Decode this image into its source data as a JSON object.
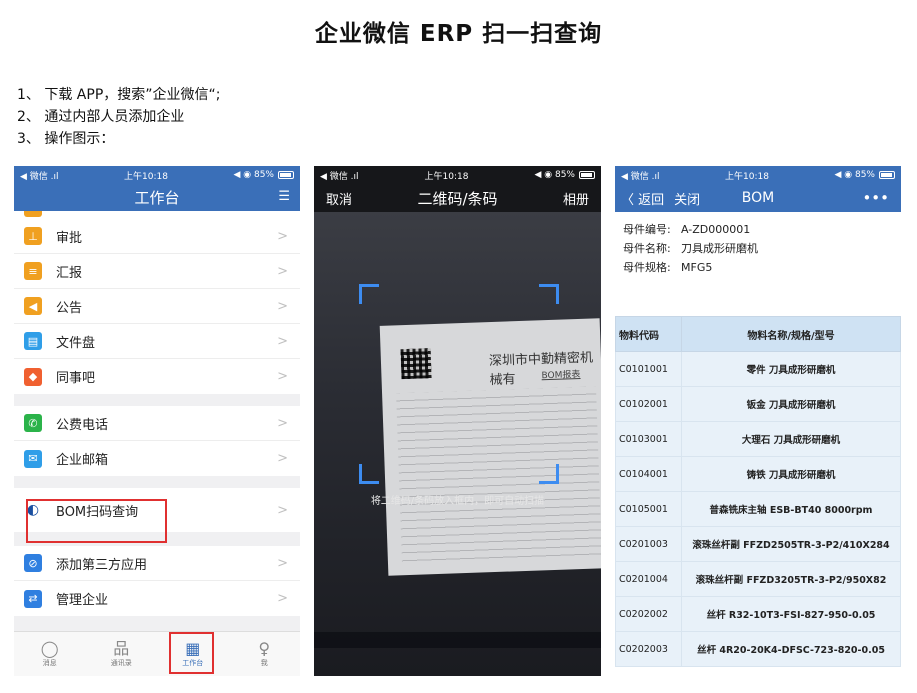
{
  "title": "企业微信 ERP 扫一扫查询",
  "steps": [
    "1、 下载 APP，搜索”企业微信“;",
    "2、 通过内部人员添加企业",
    "3、 操作图示："
  ],
  "colors": {
    "brand_blue": "#3a6fb8",
    "highlight_red": "#e03030",
    "scan_blue": "#3d8cf0"
  },
  "phone1": {
    "status": {
      "carrier": "◀ 微信 .ıl",
      "time": "上午10:18",
      "battery": "◀ ◉ 85%"
    },
    "nav_title": "工作台",
    "nav_right": "☰",
    "groups": [
      [
        {
          "label": "审批",
          "icon": "approval-icon",
          "color": "#f0a020"
        },
        {
          "label": "汇报",
          "icon": "report-icon",
          "color": "#f0a020"
        },
        {
          "label": "公告",
          "icon": "announcement-icon",
          "color": "#f0a020"
        },
        {
          "label": "文件盘",
          "icon": "file-drive-icon",
          "color": "#2f9ee8"
        },
        {
          "label": "同事吧",
          "icon": "colleague-icon",
          "color": "#f06030"
        }
      ],
      [
        {
          "label": "公费电话",
          "icon": "phone-icon",
          "color": "#2bb34a"
        },
        {
          "label": "企业邮箱",
          "icon": "mail-icon",
          "color": "#2f9ee8"
        }
      ],
      [
        {
          "label": "BOM扫码查询",
          "icon": "bom-scan-icon",
          "color": "#ffffff"
        }
      ],
      [
        {
          "label": "添加第三方应用",
          "icon": "add-app-icon",
          "color": "#2f7fe0"
        },
        {
          "label": "管理企业",
          "icon": "manage-icon",
          "color": "#2f7fe0"
        }
      ]
    ],
    "tabs": [
      {
        "label": "消息",
        "icon": "chat-icon"
      },
      {
        "label": "通讯录",
        "icon": "contacts-icon"
      },
      {
        "label": "工作台",
        "icon": "workbench-icon"
      },
      {
        "label": "我",
        "icon": "person-icon"
      }
    ]
  },
  "phone2": {
    "status": {
      "carrier": "◀ 微信 .ıl",
      "time": "上午10:18",
      "battery": "◀ ◉ 85%"
    },
    "nav_left": "取消",
    "nav_title": "二维码/条码",
    "nav_right": "相册",
    "paper_title": "深圳市中勤精密机械有",
    "paper_sub": "BOM报表",
    "hint": "将二维码/条码放入框内，即可自动扫描"
  },
  "phone3": {
    "status": {
      "carrier": "◀ 微信 .ıl",
      "time": "上午10:18",
      "battery": "◀ ◉ 85%"
    },
    "back": "〈 返回",
    "close": "关闭",
    "nav_title": "BOM",
    "more": "•••",
    "info": [
      {
        "k": "母件编号:",
        "v": "A-ZD000001"
      },
      {
        "k": "母件名称:",
        "v": "刀具成形研磨机"
      },
      {
        "k": "母件规格:",
        "v": "MFG5"
      }
    ],
    "table_headers": [
      "物料代码",
      "物料名称/规格/型号"
    ],
    "rows": [
      [
        "C0101001",
        "零件 刀具成形研磨机"
      ],
      [
        "C0102001",
        "钣金 刀具成形研磨机"
      ],
      [
        "C0103001",
        "大理石 刀具成形研磨机"
      ],
      [
        "C0104001",
        "铸铁 刀具成形研磨机"
      ],
      [
        "C0105001",
        "普森铣床主轴 ESB-BT40 8000rpm"
      ],
      [
        "C0201003",
        "滚珠丝杆副 FFZD2505TR-3-P2/410X284"
      ],
      [
        "C0201004",
        "滚珠丝杆副 FFZD3205TR-3-P2/950X82"
      ],
      [
        "C0202002",
        "丝杆 R32-10T3-FSI-827-950-0.05"
      ],
      [
        "C0202003",
        "丝杆 4R20-20K4-DFSC-723-820-0.05"
      ]
    ]
  }
}
